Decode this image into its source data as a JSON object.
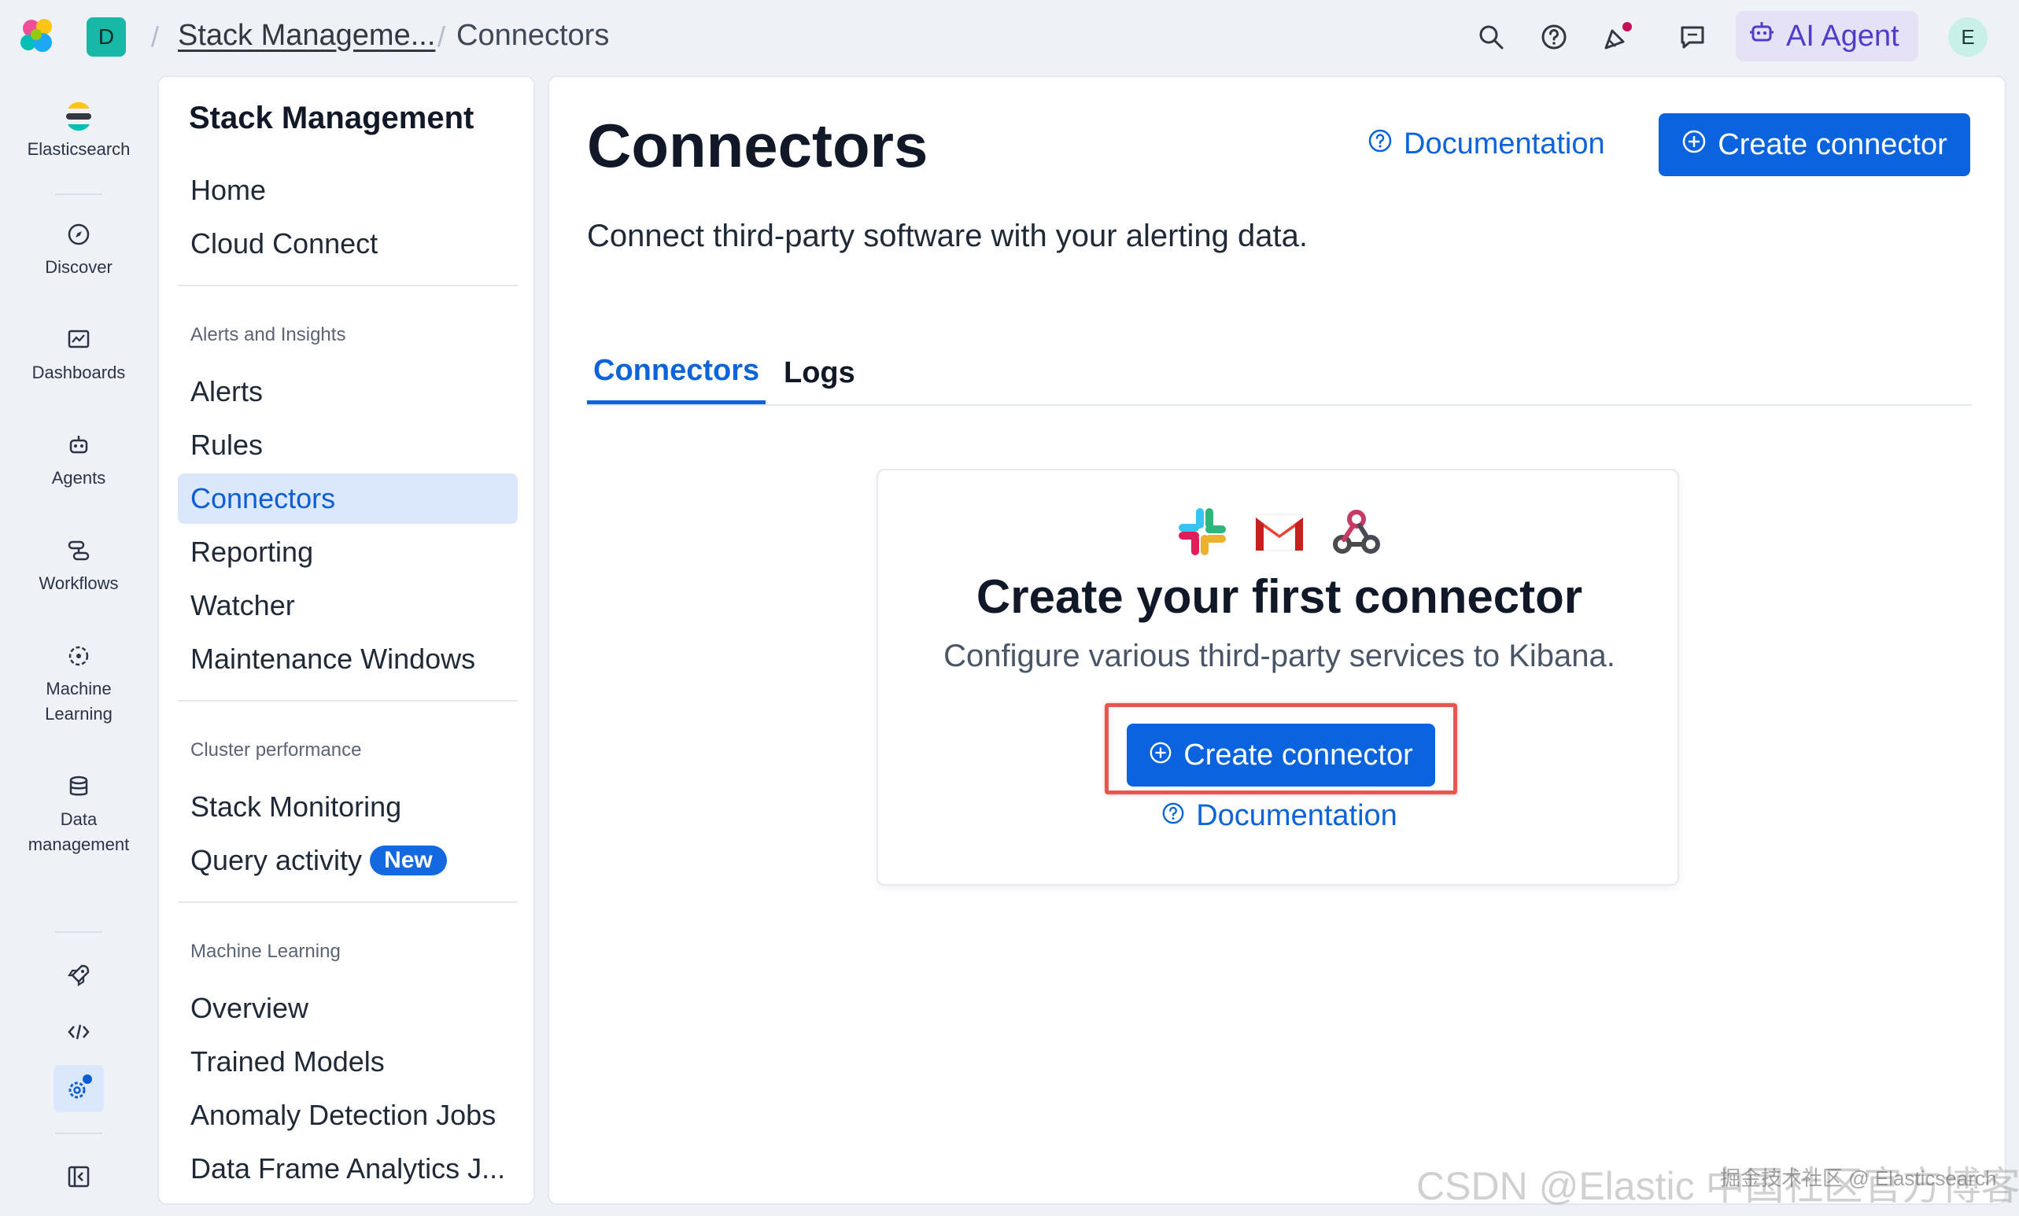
{
  "header": {
    "space_initial": "D",
    "breadcrumbs": [
      "Stack Manageme...",
      "Connectors"
    ],
    "ai_agent_label": "AI Agent",
    "user_initial": "E"
  },
  "rail": {
    "items": [
      {
        "label": "Elasticsearch"
      },
      {
        "label": "Discover"
      },
      {
        "label": "Dashboards"
      },
      {
        "label": "Agents"
      },
      {
        "label": "Workflows"
      },
      {
        "label": "Machine Learning"
      },
      {
        "label": "Data management"
      }
    ]
  },
  "sidenav": {
    "title": "Stack Management",
    "top_items": [
      "Home",
      "Cloud Connect"
    ],
    "groups": [
      {
        "label": "Alerts and Insights",
        "items": [
          "Alerts",
          "Rules",
          "Connectors",
          "Reporting",
          "Watcher",
          "Maintenance Windows"
        ]
      },
      {
        "label": "Cluster performance",
        "items": [
          "Stack Monitoring",
          "Query activity"
        ]
      },
      {
        "label": "Machine Learning",
        "items": [
          "Overview",
          "Trained Models",
          "Anomaly Detection Jobs",
          "Data Frame Analytics J..."
        ]
      }
    ],
    "new_badge": "New",
    "active_item": "Connectors"
  },
  "main": {
    "title": "Connectors",
    "documentation_label": "Documentation",
    "create_connector_label": "Create connector",
    "description": "Connect third-party software with your alerting data.",
    "tabs": [
      {
        "label": "Connectors",
        "active": true
      },
      {
        "label": "Logs",
        "active": false
      }
    ],
    "empty_state": {
      "title": "Create your first connector",
      "description": "Configure various third-party services to Kibana.",
      "button_label": "Create connector",
      "doc_label": "Documentation"
    }
  },
  "watermark": {
    "text": "CSDN @Elastic 中国社区官方博客",
    "overlay": "掘金技术社区 @ Elasticsearch"
  },
  "colors": {
    "primary": "#0b64dd",
    "accent_ai": "#4f3cc9",
    "highlight": "#e8574f",
    "active_nav_bg": "#dbe8fb"
  }
}
